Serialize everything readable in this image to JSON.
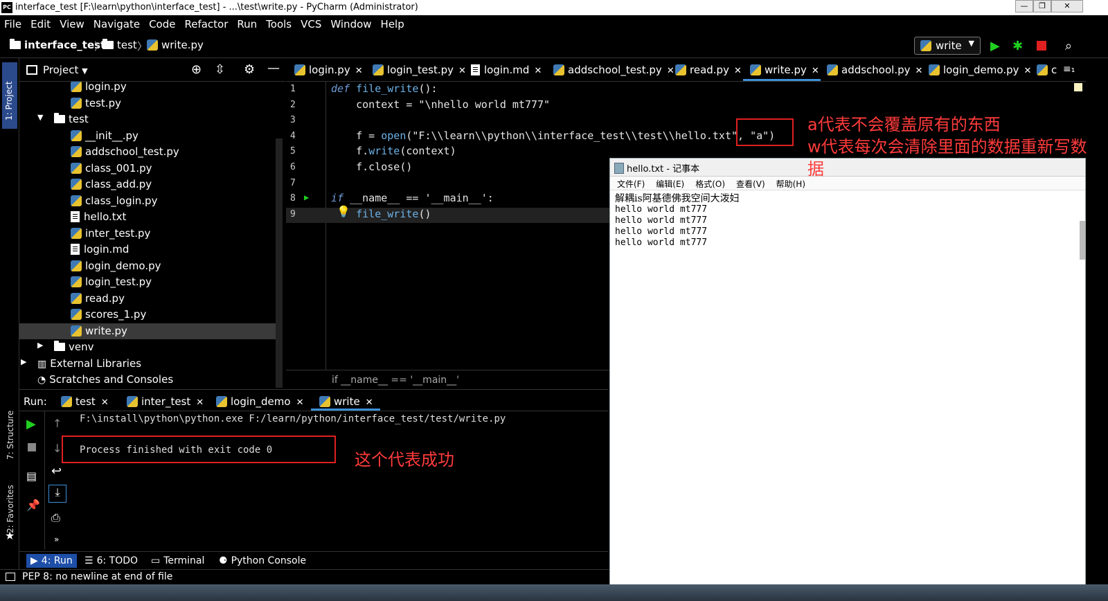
{
  "window": {
    "title": "interface_test [F:\\learn\\python\\interface_test] - ...\\test\\write.py - PyCharm (Administrator)",
    "app_badge": "PC"
  },
  "menu": [
    "File",
    "Edit",
    "View",
    "Navigate",
    "Code",
    "Refactor",
    "Run",
    "Tools",
    "VCS",
    "Window",
    "Help"
  ],
  "breadcrumb": [
    "interface_test",
    "test",
    "write.py"
  ],
  "run_config": "write",
  "left_strip": {
    "project": "1: Project",
    "structure": "7: Structure",
    "favorites": "2: Favorites"
  },
  "project_panel": {
    "title": "Project",
    "tree": [
      {
        "label": "login.py",
        "kind": "py",
        "indent": 2
      },
      {
        "label": "test.py",
        "kind": "py",
        "indent": 2
      },
      {
        "label": "test",
        "kind": "folder",
        "indent": 1,
        "expander": "▼"
      },
      {
        "label": "__init__.py",
        "kind": "py",
        "indent": 2
      },
      {
        "label": "addschool_test.py",
        "kind": "py",
        "indent": 2
      },
      {
        "label": "class_001.py",
        "kind": "py",
        "indent": 2
      },
      {
        "label": "class_add.py",
        "kind": "py",
        "indent": 2
      },
      {
        "label": "class_login.py",
        "kind": "py",
        "indent": 2
      },
      {
        "label": "hello.txt",
        "kind": "txt",
        "indent": 2
      },
      {
        "label": "inter_test.py",
        "kind": "py",
        "indent": 2
      },
      {
        "label": "login.md",
        "kind": "txt",
        "indent": 2
      },
      {
        "label": "login_demo.py",
        "kind": "py",
        "indent": 2
      },
      {
        "label": "login_test.py",
        "kind": "py",
        "indent": 2
      },
      {
        "label": "read.py",
        "kind": "py",
        "indent": 2
      },
      {
        "label": "scores_1.py",
        "kind": "py",
        "indent": 2
      },
      {
        "label": "write.py",
        "kind": "py",
        "indent": 2,
        "selected": true
      },
      {
        "label": "venv",
        "kind": "folder",
        "indent": 1,
        "expander": "▶"
      },
      {
        "label": "External Libraries",
        "kind": "lib",
        "indent": 0,
        "expander": "▶"
      },
      {
        "label": "Scratches and Consoles",
        "kind": "scratch",
        "indent": 0
      }
    ]
  },
  "editor_tabs": [
    {
      "label": "login.py",
      "kind": "py"
    },
    {
      "label": "login_test.py",
      "kind": "py"
    },
    {
      "label": "login.md",
      "kind": "txt"
    },
    {
      "label": "addschool_test.py",
      "kind": "py"
    },
    {
      "label": "read.py",
      "kind": "py"
    },
    {
      "label": "write.py",
      "kind": "py",
      "active": true
    },
    {
      "label": "addschool.py",
      "kind": "py"
    },
    {
      "label": "login_demo.py",
      "kind": "py"
    },
    {
      "label": "c",
      "kind": "py",
      "truncated": true
    }
  ],
  "tab_overflow": "≡₁",
  "code": {
    "line_numbers": [
      "1",
      "2",
      "3",
      "4",
      "5",
      "6",
      "7",
      "8",
      "9"
    ],
    "lines": [
      "<span class=\"kw\">def</span> <span class=\"fn\">file_write</span>():",
      "    context = \"\\nhello world mt777\"",
      "",
      "    f = <span class=\"fn\">open</span>(\"F:\\\\learn\\\\python\\\\interface_test\\\\test\\\\hello.txt\", \"a\")",
      "    f.<span class=\"fn\">write</span>(context)",
      "    f.close()",
      "",
      "<span class=\"kw\">if</span> __name__ == '__main__':",
      "    <span class=\"fn\">file_write</span>()"
    ],
    "breadcrumb_hint": "if __name__ == '__main__'"
  },
  "notepad": {
    "title": "hello.txt - 记事本",
    "menu": [
      "文件(F)",
      "编辑(E)",
      "格式(O)",
      "查看(V)",
      "帮助(H)"
    ],
    "lines": [
      "解耦is阿基德佛我空间大泼妇",
      "hello world mt777",
      "hello world mt777",
      "hello world mt777",
      "hello world mt777"
    ]
  },
  "run_panel": {
    "label": "Run:",
    "tabs": [
      {
        "label": "test"
      },
      {
        "label": "inter_test"
      },
      {
        "label": "login_demo"
      },
      {
        "label": "write",
        "active": true
      }
    ],
    "console": [
      "F:\\install\\python\\python.exe F:/learn/python/interface_test/test/write.py",
      "",
      "Process finished with exit code 0"
    ]
  },
  "bottom_tools": [
    {
      "label": "4: Run",
      "icon": "play-icon",
      "active": true
    },
    {
      "label": "6: TODO",
      "icon": "list-icon"
    },
    {
      "label": "Terminal",
      "icon": "terminal-icon"
    },
    {
      "label": "Python Console",
      "icon": "python-icon"
    }
  ],
  "status": "PEP 8: no newline at end of file",
  "annotations": {
    "a_mode_line1": "a代表不会覆盖原有的东西",
    "a_mode_line2": "w代表每次会清除里面的数据重新写数",
    "a_mode_line3": "据",
    "success": "这个代表成功"
  },
  "colors": {
    "annotation_red": "#e02020",
    "run_green": "#20d020",
    "stop_red": "#e02020",
    "active_tab_underline": "#3d8fd8"
  }
}
